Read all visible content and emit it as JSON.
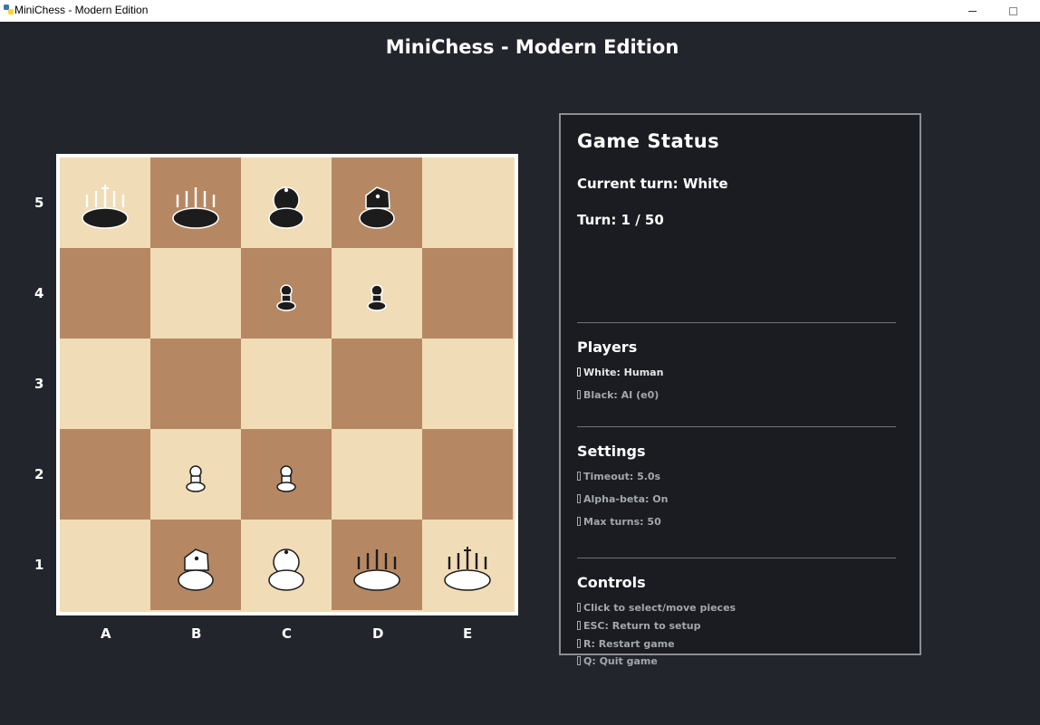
{
  "window": {
    "title": "MiniChess - Modern Edition"
  },
  "header": {
    "title": "MiniChess - Modern Edition"
  },
  "board": {
    "files": [
      "A",
      "B",
      "C",
      "D",
      "E"
    ],
    "ranks": [
      "5",
      "4",
      "3",
      "2",
      "1"
    ],
    "pieces": {
      "A5": "black-king",
      "B5": "black-queen",
      "C5": "black-bishop",
      "D5": "black-knight",
      "C4": "black-pawn",
      "D4": "black-pawn",
      "B2": "white-pawn",
      "C2": "white-pawn",
      "B1": "white-knight",
      "C1": "white-bishop",
      "D1": "white-queen",
      "E1": "white-king"
    },
    "colors": {
      "light": "#f0dcb6",
      "dark": "#b58863",
      "border": "#ffffff"
    }
  },
  "status": {
    "title": "Game Status",
    "current_turn": "Current turn: White",
    "turn_count": "Turn: 1 / 50",
    "players": {
      "title": "Players",
      "white": "White: Human",
      "black": "Black: AI (e0)"
    },
    "settings": {
      "title": "Settings",
      "timeout": "Timeout: 5.0s",
      "alpha_beta": "Alpha-beta: On",
      "max_turns": "Max turns: 50"
    },
    "controls": {
      "title": "Controls",
      "click": "Click to select/move pieces",
      "esc": "ESC: Return to setup",
      "restart": "R: Restart game",
      "quit": "Q: Quit game"
    }
  }
}
